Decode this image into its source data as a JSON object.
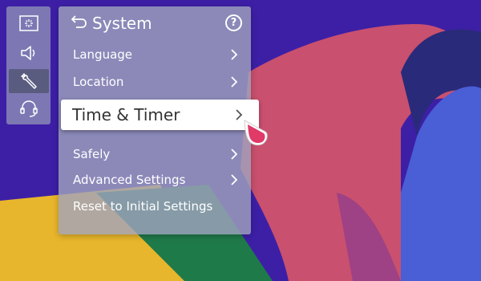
{
  "colors": {
    "wallpaper_base": "#3d1fa6",
    "ribbon_pink": "#c9506e",
    "ribbon_blue": "#4a5ed6",
    "ribbon_dark": "#2a2a7a",
    "yellow": "#e8b62c",
    "green": "#1f7a4a",
    "menu_text": "#ffffff",
    "focused_text": "#333333",
    "cursor_pink": "#e03a68"
  },
  "rail": {
    "items": [
      {
        "icon": "picture-icon",
        "active": false
      },
      {
        "icon": "speaker-icon",
        "active": false
      },
      {
        "icon": "wrench-icon",
        "active": true
      },
      {
        "icon": "headset-icon",
        "active": false
      }
    ]
  },
  "panel": {
    "back_icon": "back-arrow-icon",
    "title": "System",
    "help_icon": "help-icon",
    "help_glyph": "?"
  },
  "menu": {
    "items": [
      {
        "label": "Language",
        "has_submenu": true
      },
      {
        "label": "Location",
        "has_submenu": true
      },
      {
        "label": "Time & Timer",
        "has_submenu": true,
        "focused": true
      },
      {
        "label": "Safely",
        "has_submenu": true
      },
      {
        "label": "Advanced Settings",
        "has_submenu": true
      },
      {
        "label": "Reset to Initial Settings",
        "has_submenu": false
      }
    ]
  }
}
